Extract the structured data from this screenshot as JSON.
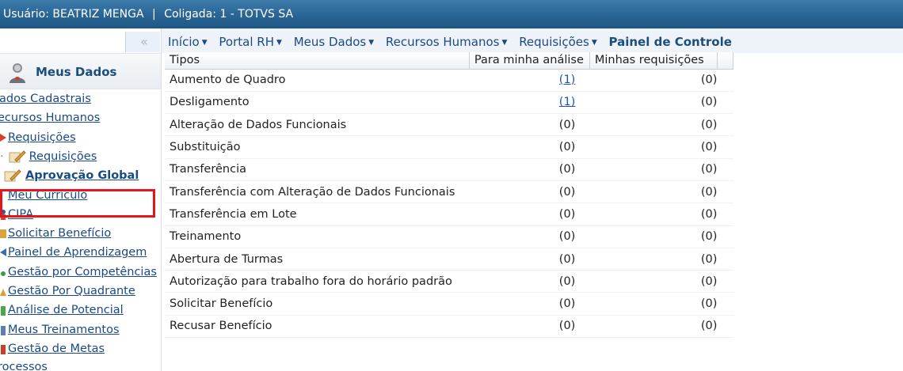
{
  "header": {
    "user_text": "Usuário: BEATRIZ MENGA",
    "separator": "|",
    "coligada_text": "Coligada: 1 - TOTVS SA"
  },
  "sidebar": {
    "collapse_label": "‹‹",
    "section_title": "Meus Dados",
    "items": [
      {
        "label": "ados Cadastrais"
      },
      {
        "label": "ecursos Humanos"
      },
      {
        "label": "Requisições"
      },
      {
        "label": "Requisições"
      },
      {
        "label": "Aprovação Global"
      },
      {
        "label": "Meu Currículo"
      },
      {
        "label": "CIPA"
      },
      {
        "label": "Solicitar Benefício"
      },
      {
        "label": "Painel de Aprendizagem"
      },
      {
        "label": "Gestão por Competências"
      },
      {
        "label": "Gestão Por Quadrante"
      },
      {
        "label": "Análise de Potencial"
      },
      {
        "label": "Meus Treinamentos"
      },
      {
        "label": "Gestão de Metas"
      },
      {
        "label": "rocessos"
      }
    ]
  },
  "breadcrumb": {
    "items": [
      "Início",
      "Portal RH",
      "Meus Dados",
      "Recursos Humanos",
      "Requisições"
    ],
    "current": "Painel de Controle"
  },
  "table": {
    "headers": [
      "Tipos",
      "Para minha análise",
      "Minhas requisições"
    ],
    "rows": [
      {
        "tipo": "Aumento de Quadro",
        "analise": "(1)",
        "minhas": "(0)"
      },
      {
        "tipo": "Desligamento",
        "analise": "(1)",
        "minhas": "(0)"
      },
      {
        "tipo": "Alteração de Dados Funcionais",
        "analise": "(0)",
        "minhas": "(0)"
      },
      {
        "tipo": "Substituição",
        "analise": "(0)",
        "minhas": "(0)"
      },
      {
        "tipo": "Transferência",
        "analise": "(0)",
        "minhas": "(0)"
      },
      {
        "tipo": "Transferência com Alteração de Dados Funcionais",
        "analise": "(0)",
        "minhas": "(0)"
      },
      {
        "tipo": "Transferência em Lote",
        "analise": "(0)",
        "minhas": "(0)"
      },
      {
        "tipo": "Treinamento",
        "analise": "(0)",
        "minhas": "(0)"
      },
      {
        "tipo": "Abertura de Turmas",
        "analise": "(0)",
        "minhas": "(0)"
      },
      {
        "tipo": "Autorização para trabalho fora do horário padrão",
        "analise": "(0)",
        "minhas": "(0)"
      },
      {
        "tipo": "Solicitar Benefício",
        "analise": "(0)",
        "minhas": "(0)"
      },
      {
        "tipo": "Recusar Benefício",
        "analise": "(0)",
        "minhas": "(0)"
      }
    ]
  },
  "colors": {
    "header_bg": "#2a6596",
    "link": "#1a4a86",
    "highlight": "#e8141c"
  }
}
